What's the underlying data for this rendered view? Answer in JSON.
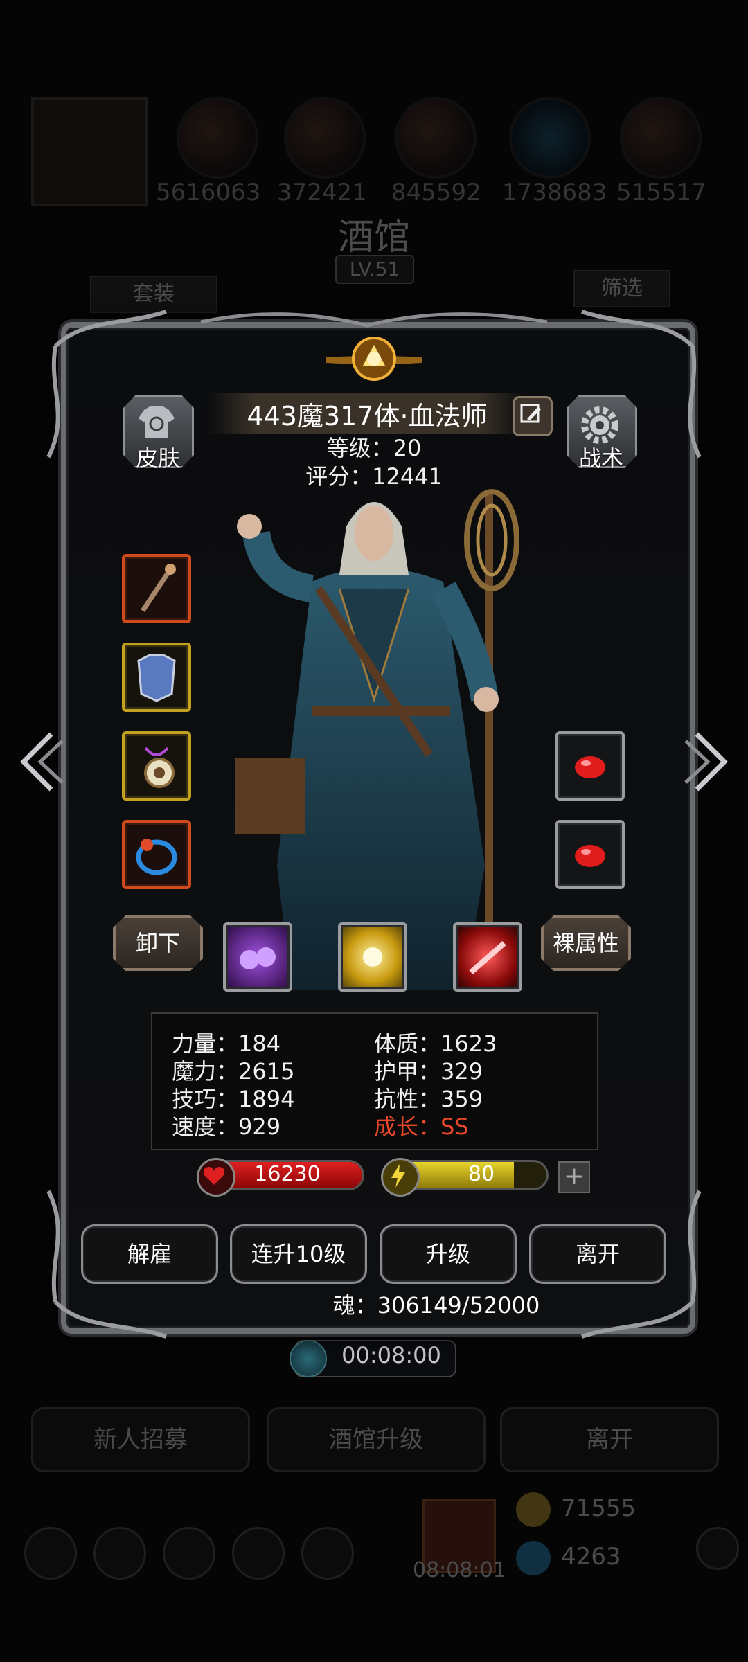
{
  "background": {
    "top_slot_numbers": [
      "5616063",
      "372421",
      "845592",
      "1738683",
      "515517"
    ],
    "screen_title": "酒馆",
    "screen_level": "LV.51",
    "set_button": "套装",
    "filter_button": "筛选",
    "timer": "00:08:00",
    "recruit_button": "新人招募",
    "upgrade_tavern_button": "酒馆升级",
    "leave_button": "离开",
    "gift_timer": "08:08:01",
    "gold_amount": "71555",
    "gem_amount": "4263"
  },
  "hero": {
    "name": "443魔317体·血法师",
    "level": "等级：20",
    "score": "评分：12441"
  },
  "side_buttons": {
    "skin": "皮肤",
    "tactics": "战术"
  },
  "actions": {
    "unequip": "卸下",
    "naked_stats": "裸属性"
  },
  "stats": {
    "strength": "力量：184",
    "magic": "魔力：2615",
    "skill": "技巧：1894",
    "speed": "速度：929",
    "constitution": "体质：1623",
    "armor": "护甲：329",
    "resistance": "抗性：359",
    "growth": "成长：SS"
  },
  "bars": {
    "hp": "16230",
    "hp_fraction": 1.0,
    "energy": "80",
    "energy_fraction": 0.8
  },
  "buttons": {
    "dismiss": "解雇",
    "level_up_10": "连升10级",
    "level_up": "升级",
    "leave": "离开"
  },
  "soul": "魂：306149/52000",
  "colors": {
    "growth": "#e8472a",
    "hp": "#d01818",
    "energy": "#e0cc26"
  }
}
